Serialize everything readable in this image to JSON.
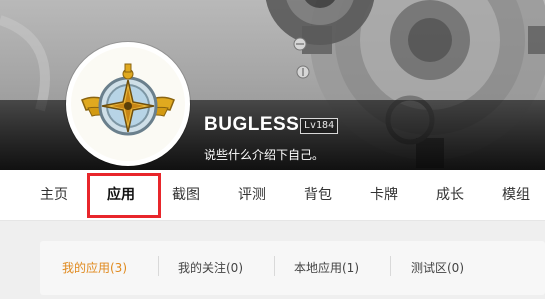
{
  "profile": {
    "username": "BUGLESS",
    "level": "Lv184",
    "bio": "说些什么介绍下自己。"
  },
  "nav": {
    "tabs": [
      {
        "label": "主页"
      },
      {
        "label": "应用",
        "active": true
      },
      {
        "label": "截图"
      },
      {
        "label": "评测"
      },
      {
        "label": "背包"
      },
      {
        "label": "卡牌"
      },
      {
        "label": "成长"
      },
      {
        "label": "模组"
      }
    ]
  },
  "subtabs": [
    {
      "label": "我的应用(3)",
      "active": true
    },
    {
      "label": "我的关注(0)"
    },
    {
      "label": "本地应用(1)"
    },
    {
      "label": "测试区(0)"
    }
  ],
  "colors": {
    "accent": "#e08a1e",
    "highlight": "#e8262b"
  },
  "icons": {
    "avatar": "compass-emblem-icon",
    "banner": "gear-decoration"
  }
}
